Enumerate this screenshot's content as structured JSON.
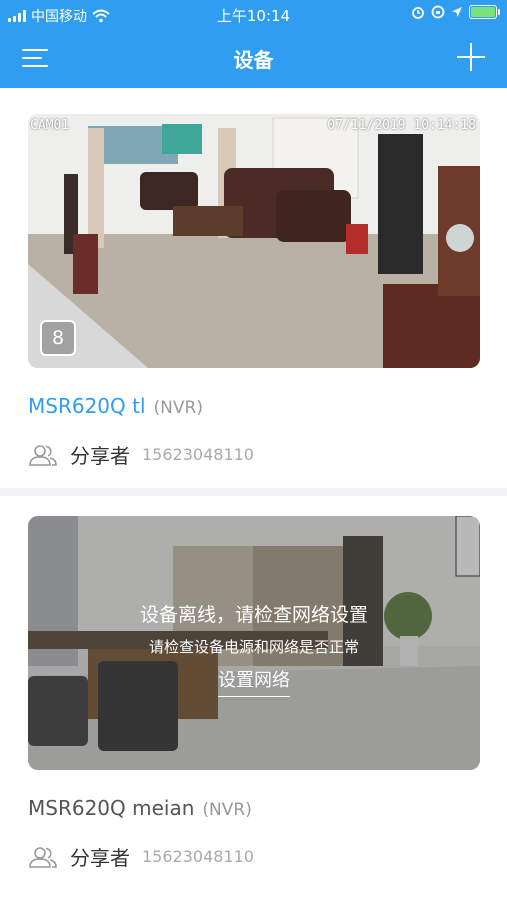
{
  "status_bar": {
    "carrier": "中国移动",
    "time": "上午10:14",
    "battery_level": 1.0
  },
  "nav": {
    "title": "设备",
    "menu_icon": "hamburger-menu-icon",
    "add_icon": "plus-icon"
  },
  "devices": [
    {
      "channel_label": "CAM01",
      "timestamp": "07/11/2019 10:14:18",
      "channel_count": "8",
      "name": "MSR620Q tl",
      "type": "(NVR)",
      "share_label": "分享者",
      "share_phone": "15623048110",
      "online": true
    },
    {
      "offline_title": "设备离线，请检查网络设置",
      "offline_subtitle": "请检查设备电源和网络是否正常",
      "offline_action": "设置网络",
      "name": "MSR620Q meian",
      "type": "(NVR)",
      "share_label": "分享者",
      "share_phone": "15623048110",
      "online": false
    }
  ],
  "colors": {
    "primary": "#2f9df0",
    "offline_name": "#555555"
  }
}
